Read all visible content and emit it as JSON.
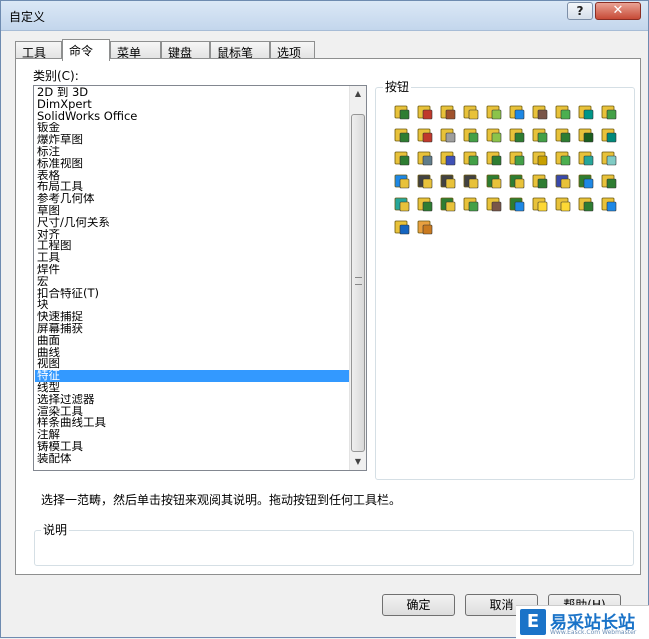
{
  "window": {
    "title": "自定义"
  },
  "titlebar": {
    "help_label": "?",
    "close_label": "✕"
  },
  "tabs": [
    {
      "label": "工具栏",
      "active": false
    },
    {
      "label": "命令",
      "active": true
    },
    {
      "label": "菜单",
      "active": false
    },
    {
      "label": "键盘",
      "active": false
    },
    {
      "label": "鼠标笔势",
      "active": false
    },
    {
      "label": "选项",
      "active": false
    }
  ],
  "categories": {
    "label": "类别(C):",
    "items": [
      "2D 到 3D",
      "DimXpert",
      "SolidWorks Office",
      "钣金",
      "爆炸草图",
      "标注",
      "标准视图",
      "表格",
      "布局工具",
      "参考几何体",
      "草图",
      "尺寸/几何关系",
      "对齐",
      "工程图",
      "工具",
      "焊件",
      "宏",
      "扣合特征(T)",
      "块",
      "快速捕捉",
      "屏幕捕获",
      "曲面",
      "曲线",
      "视图",
      "特征",
      "线型",
      "选择过滤器",
      "渲染工具",
      "样条曲线工具",
      "注解",
      "铸模工具",
      "装配体"
    ],
    "selected_index": 24
  },
  "buttons_group": {
    "label": "按钮"
  },
  "icons": [
    {
      "name": "extruded-boss-icon",
      "color": "#e8c23a",
      "accent": "#2f7d32"
    },
    {
      "name": "revolved-boss-icon",
      "color": "#e8c23a",
      "accent": "#c0392b"
    },
    {
      "name": "swept-boss-icon",
      "color": "#e8c23a",
      "accent": "#a0522d"
    },
    {
      "name": "lofted-boss-icon",
      "color": "#e8c23a",
      "accent": "#e8c23a"
    },
    {
      "name": "boundary-boss-icon",
      "color": "#e8c23a",
      "accent": "#8bc34a"
    },
    {
      "name": "extruded-cut-icon",
      "color": "#e8c23a",
      "accent": "#1e88e5"
    },
    {
      "name": "hole-wizard-icon",
      "color": "#e8c23a",
      "accent": "#795548"
    },
    {
      "name": "revolved-cut-icon",
      "color": "#e8c23a",
      "accent": "#4caf50"
    },
    {
      "name": "swept-cut-icon",
      "color": "#e8c23a",
      "accent": "#009688"
    },
    {
      "name": "lofted-cut-icon",
      "color": "#e8c23a",
      "accent": "#43a047"
    },
    {
      "name": "boundary-cut-icon",
      "color": "#e8c23a",
      "accent": "#2e7d32"
    },
    {
      "name": "fillet-icon",
      "color": "#e8c23a",
      "accent": "#c0392b"
    },
    {
      "name": "chamfer-icon",
      "color": "#e8c23a",
      "accent": "#9e9e9e"
    },
    {
      "name": "rib-icon",
      "color": "#e8c23a",
      "accent": "#43a047"
    },
    {
      "name": "draft-icon",
      "color": "#e8c23a",
      "accent": "#8bc34a"
    },
    {
      "name": "shell-icon",
      "color": "#e8c23a",
      "accent": "#2e7d32"
    },
    {
      "name": "dome-icon",
      "color": "#e8c23a",
      "accent": "#43a047"
    },
    {
      "name": "wrap-icon",
      "color": "#e8c23a",
      "accent": "#2e7d32"
    },
    {
      "name": "linear-pattern-icon",
      "color": "#e8c23a",
      "accent": "#1b5e20"
    },
    {
      "name": "circular-pattern-icon",
      "color": "#e8c23a",
      "accent": "#00897b"
    },
    {
      "name": "mirror-icon",
      "color": "#e8c23a",
      "accent": "#2e7d32"
    },
    {
      "name": "intersect-icon",
      "color": "#e8c23a",
      "accent": "#607d8b"
    },
    {
      "name": "split-icon",
      "color": "#e8c23a",
      "accent": "#3f51b5"
    },
    {
      "name": "combine-icon",
      "color": "#e8c23a",
      "accent": "#43a047"
    },
    {
      "name": "move-face-icon",
      "color": "#e8c23a",
      "accent": "#2e7d32"
    },
    {
      "name": "delete-face-icon",
      "color": "#e8c23a",
      "accent": "#43a047"
    },
    {
      "name": "flex-icon",
      "color": "#e8c23a",
      "accent": "#c8a000"
    },
    {
      "name": "freeform-icon",
      "color": "#e8c23a",
      "accent": "#4caf50"
    },
    {
      "name": "indent-icon",
      "color": "#e8c23a",
      "accent": "#26a69a"
    },
    {
      "name": "deform-icon",
      "color": "#e8c23a",
      "accent": "#80cbc4"
    },
    {
      "name": "curve-driven-pattern-icon",
      "color": "#1e88e5",
      "accent": "#e8c23a"
    },
    {
      "name": "sketch-driven-pattern-icon",
      "color": "#424242",
      "accent": "#e8c23a"
    },
    {
      "name": "table-driven-pattern-icon",
      "color": "#424242",
      "accent": "#e8c23a"
    },
    {
      "name": "fill-pattern-icon",
      "color": "#424242",
      "accent": "#e8c23a"
    },
    {
      "name": "variable-pattern-icon",
      "color": "#2e7d32",
      "accent": "#e8c23a"
    },
    {
      "name": "cosmetic-thread-icon",
      "color": "#2e7d32",
      "accent": "#e8c23a"
    },
    {
      "name": "thicken-icon",
      "color": "#e8c23a",
      "accent": "#2e7d32"
    },
    {
      "name": "scale-icon",
      "color": "#3949ab",
      "accent": "#e8c23a"
    },
    {
      "name": "point-pattern-icon",
      "color": "#2e7d32",
      "accent": "#1e88e5"
    },
    {
      "name": "library-feature-icon",
      "color": "#e8c23a",
      "accent": "#2e7d32"
    },
    {
      "name": "imported-body-icon",
      "color": "#26a69a",
      "accent": "#e8c23a"
    },
    {
      "name": "thread-icon",
      "color": "#e8c23a",
      "accent": "#2e7d32"
    },
    {
      "name": "body-move-icon",
      "color": "#2e7d32",
      "accent": "#e8c23a"
    },
    {
      "name": "cavity-icon",
      "color": "#e8c23a",
      "accent": "#43a047"
    },
    {
      "name": "cut-with-surface-icon",
      "color": "#e8c23a",
      "accent": "#795548"
    },
    {
      "name": "3d-curve-icon",
      "color": "#2e7d32",
      "accent": "#1e88e5"
    },
    {
      "name": "instant-3d-icon",
      "color": "#e8c23a",
      "accent": "#fdd835"
    },
    {
      "name": "move-copy-body-icon",
      "color": "#e8c23a",
      "accent": "#fdd835"
    },
    {
      "name": "stack-body-icon",
      "color": "#e8c23a",
      "accent": "#2e7d32"
    },
    {
      "name": "feature-tree-icon",
      "color": "#e8c23a",
      "accent": "#1e88e5"
    },
    {
      "name": "checklist-icon",
      "color": "#e8c23a",
      "accent": "#1565c0"
    },
    {
      "name": "3d-grid-icon",
      "color": "#e8a040",
      "accent": "#c97a20"
    }
  ],
  "hint_text": "选择一范畴，然后单击按钮来观阅其说明。拖动按钮到任何工具栏。",
  "description_group": {
    "label": "说明"
  },
  "footer": {
    "ok_label": "确定",
    "cancel_label": "取消",
    "help_label": "帮助(H)"
  },
  "watermark": {
    "logo": "E",
    "text": "易采站长站",
    "sub": "Www.Easck.Com Webmaster"
  }
}
